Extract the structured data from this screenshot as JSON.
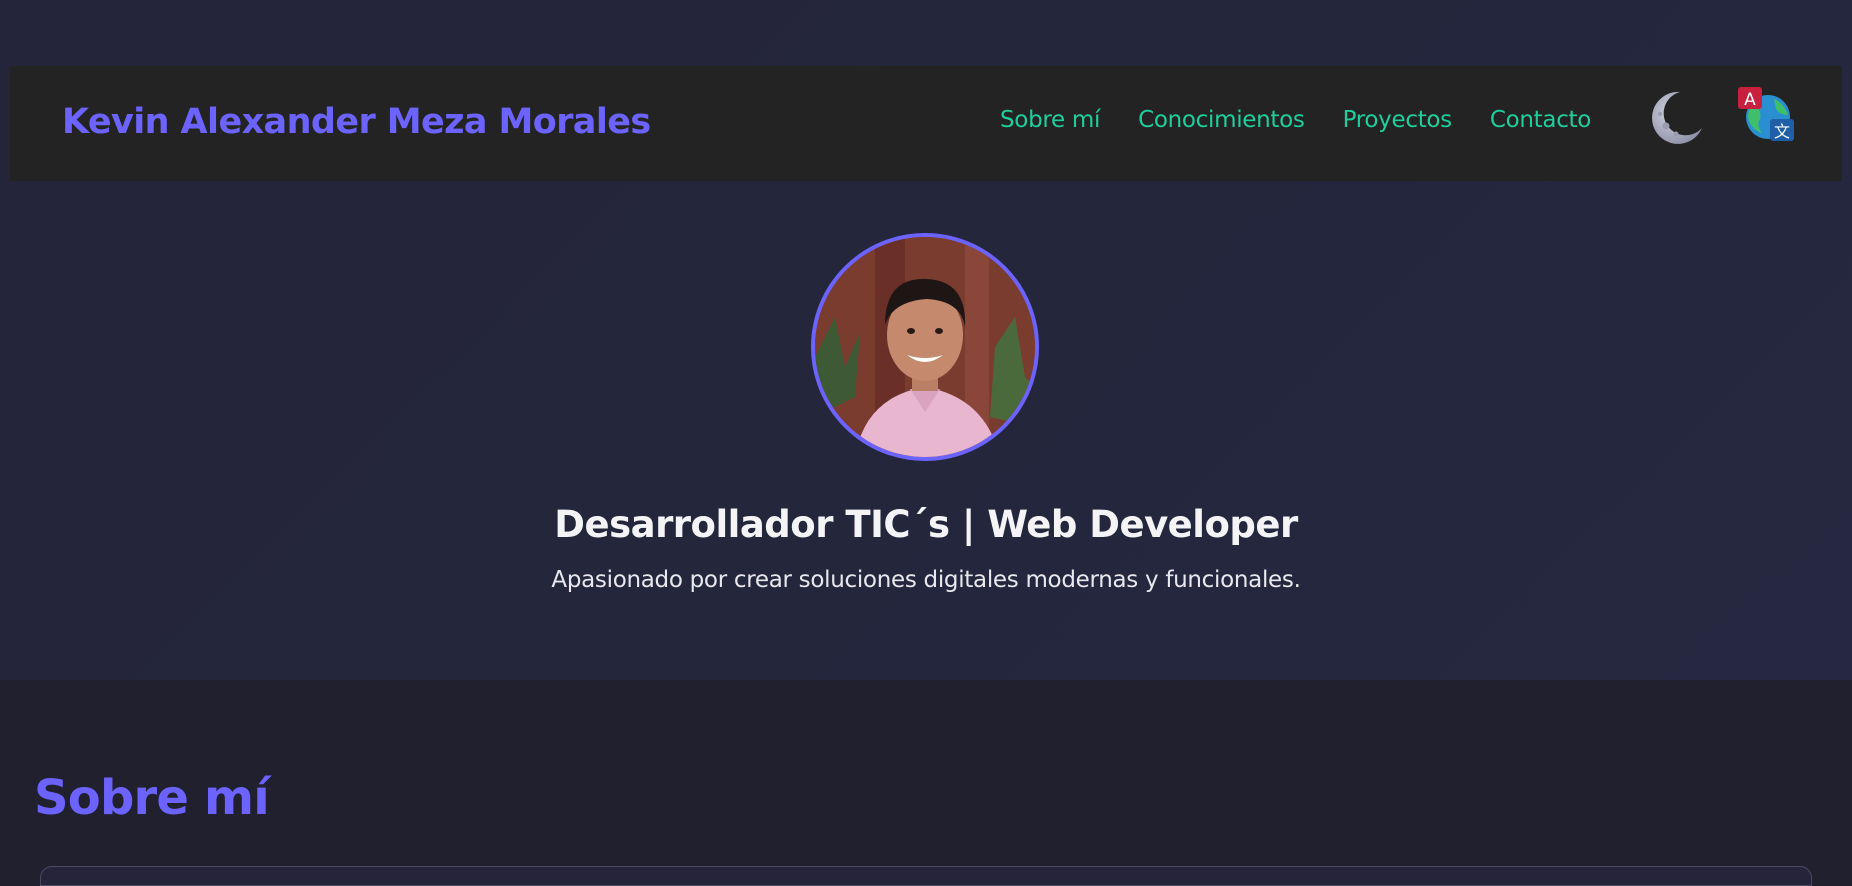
{
  "navbar": {
    "brand": "Kevin Alexander Meza Morales",
    "links": [
      {
        "label": "Sobre mí"
      },
      {
        "label": "Conocimientos"
      },
      {
        "label": "Proyectos"
      },
      {
        "label": "Contacto"
      }
    ],
    "theme_toggle_icon": "moon-icon",
    "language_toggle_icon": "translate-icon",
    "language_toggle_letters": [
      "A",
      "文"
    ]
  },
  "hero": {
    "avatar": "profile-photo",
    "headline": "Desarrollador TIC´s | Web Developer",
    "tagline": "Apasionado por crear soluciones digitales modernas y funcionales."
  },
  "about": {
    "title": "Sobre mí"
  },
  "colors": {
    "accent": "#6c63ff",
    "link": "#1fcf9b",
    "navbar_bg": "#232323",
    "page_bg": "#21202f"
  }
}
